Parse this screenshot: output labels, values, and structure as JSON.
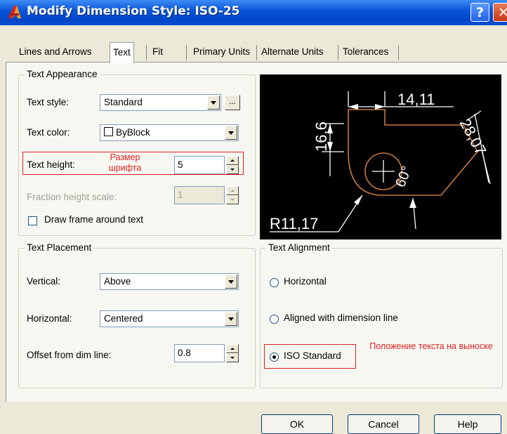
{
  "window": {
    "title": "Modify Dimension Style: ISO-25",
    "help_glyph": "?",
    "close_glyph": "✕"
  },
  "tabs": [
    {
      "label": "Lines and Arrows"
    },
    {
      "label": "Text"
    },
    {
      "label": "Fit"
    },
    {
      "label": "Primary Units"
    },
    {
      "label": "Alternate Units"
    },
    {
      "label": "Tolerances"
    }
  ],
  "active_tab": "Text",
  "text_appearance": {
    "title": "Text Appearance",
    "text_style": {
      "label": "Text style:",
      "value": "Standard",
      "browse": "..."
    },
    "text_color": {
      "label": "Text color:",
      "value": "ByBlock"
    },
    "text_height": {
      "label": "Text height:",
      "value": "5",
      "annotation": "Размер шрифта"
    },
    "fraction_height": {
      "label": "Fraction height scale:",
      "value": "1",
      "enabled": false
    },
    "draw_frame": {
      "label": "Draw frame around text",
      "checked": false
    }
  },
  "preview": {
    "dim_top": "14,11",
    "dim_left": "16,6",
    "dim_right": "28,07",
    "angle": "60°",
    "radius": "R11,17"
  },
  "text_placement": {
    "title": "Text Placement",
    "vertical": {
      "label": "Vertical:",
      "value": "Above"
    },
    "horizontal": {
      "label": "Horizontal:",
      "value": "Centered"
    },
    "offset": {
      "label": "Offset from dim line:",
      "value": "0.8"
    }
  },
  "text_alignment": {
    "title": "Text Alignment",
    "options": [
      {
        "label": "Horizontal",
        "selected": false
      },
      {
        "label": "Aligned with dimension line",
        "selected": false
      },
      {
        "label": "ISO Standard",
        "selected": true
      }
    ],
    "annotation": "Положение текста на выноске"
  },
  "buttons": {
    "ok": "OK",
    "cancel": "Cancel",
    "help": "Help"
  },
  "colors": {
    "title_bar": "#0a57d9",
    "annotation_red": "#e02020",
    "preview_bg": "#000000",
    "preview_geometry": "#c8783c",
    "preview_dims": "#ffffff"
  }
}
